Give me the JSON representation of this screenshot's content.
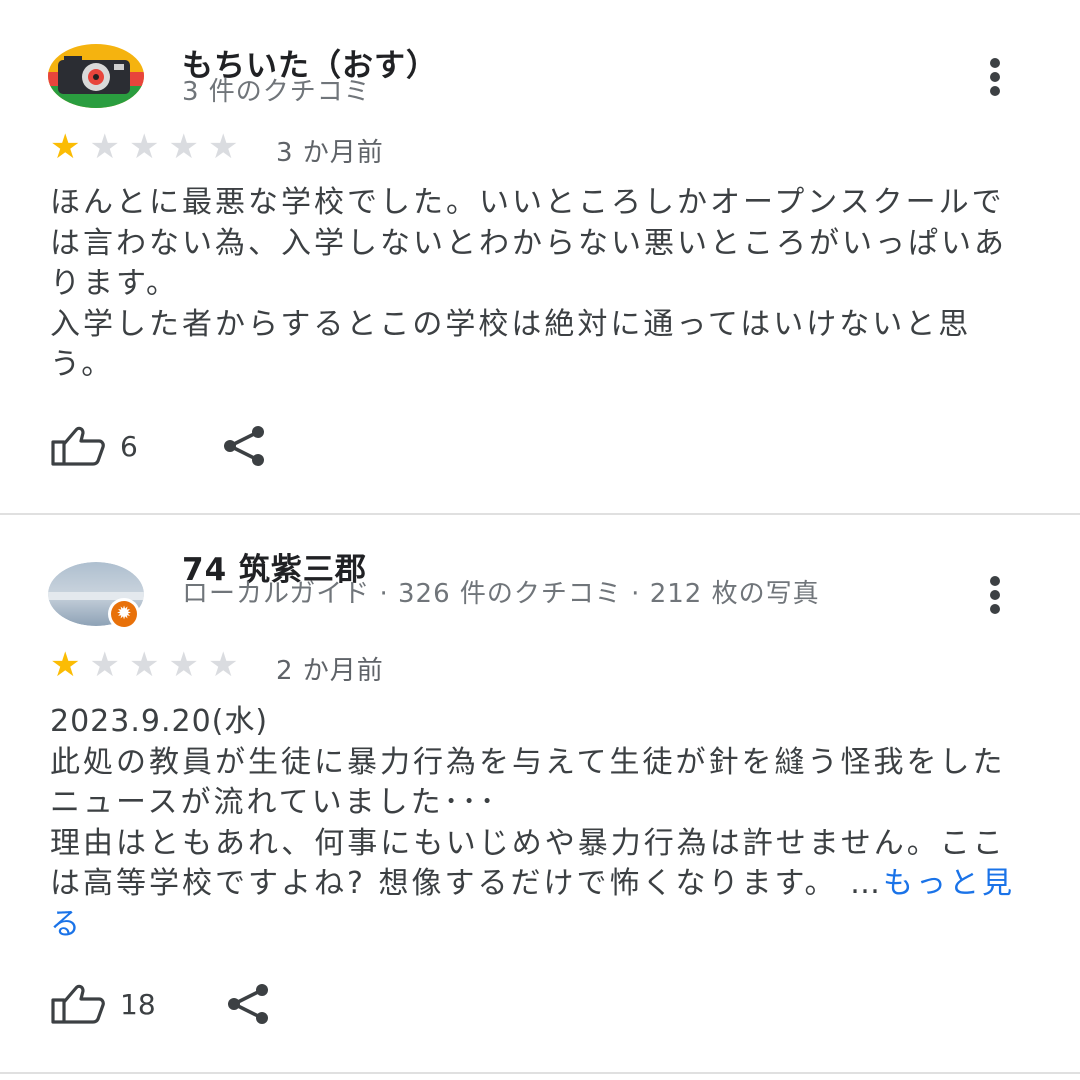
{
  "reviews": [
    {
      "author": "もちいた（おす）",
      "meta": "3 件のクチコミ",
      "rating": 1,
      "max_rating": 5,
      "date": "3 か月前",
      "paragraphs": [
        "ほんとに最悪な学校でした。いいところしかオープンスクールでは言わない為、入学しないとわからない悪いところがいっぱいあります。",
        "入学した者からするとこの学校は絶対に通ってはいけないと思う。"
      ],
      "likes": "6"
    },
    {
      "author": "74 筑紫三郡",
      "meta": "ローカルガイド · 326 件のクチコミ · 212 枚の写真",
      "rating": 1,
      "max_rating": 5,
      "date": "2 か月前",
      "paragraphs": [
        "2023.9.20(水)",
        "此処の教員が生徒に暴力行為を与えて生徒が針を縫う怪我をしたニュースが流れていました･･･",
        "理由はともあれ、何事にもいじめや暴力行為は許せません。ここは高等学校ですよね? 想像するだけで怖くなります。"
      ],
      "ellipsis": "…",
      "more_label": "もっと見る",
      "likes": "18"
    }
  ],
  "icons": {
    "thumbs_up": "thumbs-up-icon",
    "share": "share-icon",
    "menu": "more-vert-icon",
    "local_guide_badge": "local-guide-badge-icon"
  },
  "colors": {
    "star_on": "#fbbc04",
    "star_off": "#dadce0",
    "link": "#1a73e8"
  }
}
